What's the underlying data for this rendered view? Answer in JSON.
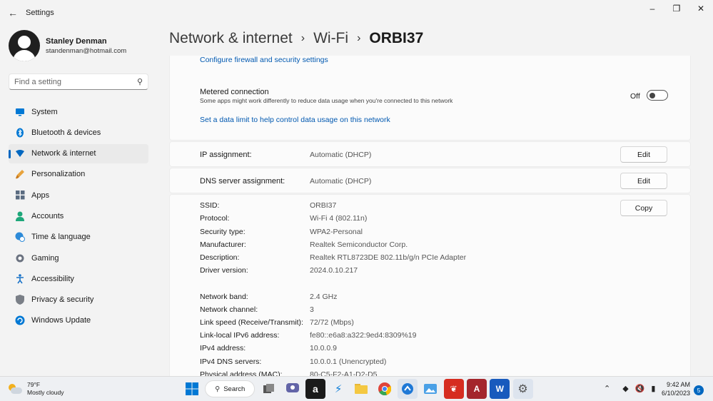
{
  "window": {
    "title": "Settings",
    "back_icon": "back-arrow-icon"
  },
  "profile": {
    "name": "Stanley Denman",
    "email": "standenman@hotmail.com"
  },
  "search": {
    "placeholder": "Find a setting"
  },
  "nav": {
    "items": [
      {
        "label": "System",
        "icon": "monitor-icon",
        "color": "#0078d4"
      },
      {
        "label": "Bluetooth & devices",
        "icon": "bluetooth-icon",
        "color": "#0078d4"
      },
      {
        "label": "Network & internet",
        "icon": "wifi-diamond-icon",
        "color": "#0067c0",
        "active": true
      },
      {
        "label": "Personalization",
        "icon": "brush-icon",
        "color": "#e8a33c"
      },
      {
        "label": "Apps",
        "icon": "apps-grid-icon",
        "color": "#5a6b80"
      },
      {
        "label": "Accounts",
        "icon": "person-icon",
        "color": "#1ea77a"
      },
      {
        "label": "Time & language",
        "icon": "globe-clock-icon",
        "color": "#2d8ad8"
      },
      {
        "label": "Gaming",
        "icon": "controller-icon",
        "color": "#6b7280"
      },
      {
        "label": "Accessibility",
        "icon": "accessibility-icon",
        "color": "#1a73c8"
      },
      {
        "label": "Privacy & security",
        "icon": "shield-icon",
        "color": "#7a7f87"
      },
      {
        "label": "Windows Update",
        "icon": "refresh-icon",
        "color": "#0078d4"
      }
    ]
  },
  "header": {
    "crumb1": "Network & internet",
    "crumb2": "Wi-Fi",
    "current": "ORBI37"
  },
  "metered": {
    "firewall_link": "Configure firewall and security settings",
    "title": "Metered connection",
    "description": "Some apps might work differently to reduce data usage when you're connected to this network",
    "toggle_label": "Off",
    "data_limit_link": "Set a data limit to help control data usage on this network"
  },
  "ip_assignment": {
    "label": "IP assignment:",
    "value": "Automatic (DHCP)",
    "button": "Edit"
  },
  "dns_assignment": {
    "label": "DNS server assignment:",
    "value": "Automatic (DHCP)",
    "button": "Edit"
  },
  "properties": {
    "copy_button": "Copy",
    "rows": [
      {
        "k": "SSID:",
        "v": "ORBI37"
      },
      {
        "k": "Protocol:",
        "v": "Wi-Fi 4 (802.11n)"
      },
      {
        "k": "Security type:",
        "v": "WPA2-Personal"
      },
      {
        "k": "Manufacturer:",
        "v": "Realtek Semiconductor Corp."
      },
      {
        "k": "Description:",
        "v": "Realtek RTL8723DE 802.11b/g/n PCIe Adapter"
      },
      {
        "k": "Driver version:",
        "v": "2024.0.10.217"
      },
      {
        "k": "Network band:",
        "v": "2.4 GHz"
      },
      {
        "k": "Network channel:",
        "v": "3"
      },
      {
        "k": "Link speed (Receive/Transmit):",
        "v": "72/72 (Mbps)"
      },
      {
        "k": "Link-local IPv6 address:",
        "v": "fe80::e6a8:a322:9ed4:8309%19"
      },
      {
        "k": "IPv4 address:",
        "v": "10.0.0.9"
      },
      {
        "k": "IPv4 DNS servers:",
        "v": "10.0.0.1 (Unencrypted)"
      },
      {
        "k": "Physical address (MAC):",
        "v": "80-C5-F2-A1-D2-D5"
      }
    ]
  },
  "taskbar": {
    "weather_temp": "79°F",
    "weather_desc": "Mostly cloudy",
    "search_label": "Search",
    "time": "9:42 AM",
    "date": "6/10/2023",
    "notification_count": "5"
  }
}
